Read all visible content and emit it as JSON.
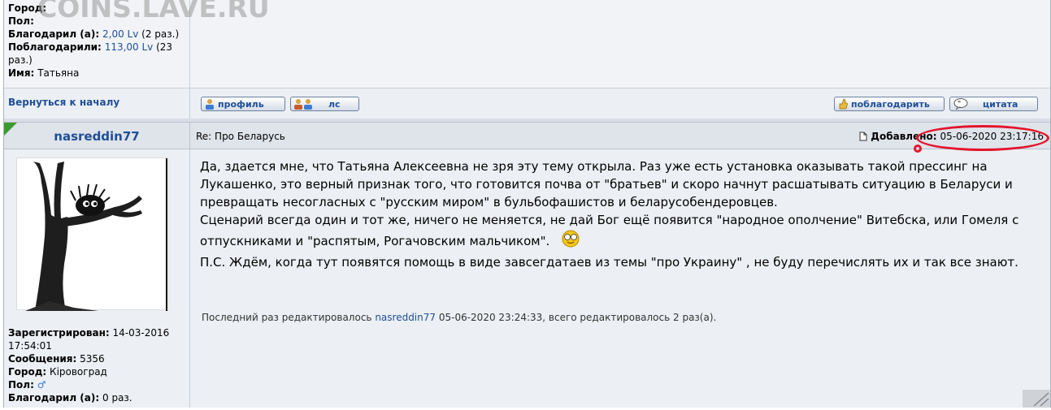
{
  "watermark": "COINS.LAVE.RU",
  "prev_post": {
    "user_info": [
      {
        "label": "Город:",
        "value": "",
        "cut": true
      },
      {
        "label": "Пол:",
        "value": ""
      },
      {
        "label": "Благодарил (а):",
        "value": "2,00 Lv",
        "suffix": " (2 раз.)"
      },
      {
        "label": "Поблагодарили:",
        "value": "113,00 Lv",
        "suffix": " (23 раз.)"
      },
      {
        "label": "Имя:",
        "value": "Татьяна"
      }
    ],
    "back_to_top": "Вернуться к началу",
    "buttons": {
      "profile": "профиль",
      "pm": "лс",
      "thank": "поблагодарить",
      "quote": "цитата"
    }
  },
  "post": {
    "author": "nasreddin77",
    "subject": "Re: Про Беларусь",
    "added_label": "Добавлено:",
    "added_date": "05-06-2020 23:17:16",
    "paragraphs": [
      "Да, здается мне, что Татьяна Алексеевна не зря эту тему открыла. Раз уже есть установка оказывать такой прессинг на Лукашенко, это верный признак того, что готовится почва от \"братьев\" и скоро начнут расшатывать ситуацию в Беларуси и превращать несогласных с \"русским миром\" в бульбофашистов и беларусобендеровцев.",
      "Сценарий всегда один и тот же, ничего не меняется, не дай Бог ещё появится \"народное ополчение\" Витебска, или Гомеля с отпускниками и \"распятым, Рогачовским мальчиком\".",
      "П.С. Ждём, когда тут появятся помощь в виде завсегдатаев из темы \"про Украину\" , не буду перечислять их и так все знают."
    ],
    "edited_prefix": "Последний раз редактировалось ",
    "edited_user": "nasreddin77",
    "edited_suffix": " 05-06-2020 23:24:33, всего редактировалось 2 раз(а).",
    "user_info": [
      {
        "label": "Зарегистрирован:",
        "value": "14-03-2016 17:54:01"
      },
      {
        "label": "Сообщения:",
        "value": "5356"
      },
      {
        "label": "Город:",
        "value": "Кіровоград"
      },
      {
        "label": "Пол:",
        "value": "♂"
      },
      {
        "label": "Благодарил (а):",
        "value": "0 раз."
      }
    ]
  },
  "colors": {
    "author": "#1f4f97",
    "highlight_circle": "#e3142b",
    "new_post_marker": "#3c9a2f"
  },
  "icons": [
    "user-icon",
    "users-icon",
    "thumb-up-icon",
    "quote-icon",
    "post-icon",
    "smiley-icon",
    "resize-grip-icon"
  ]
}
